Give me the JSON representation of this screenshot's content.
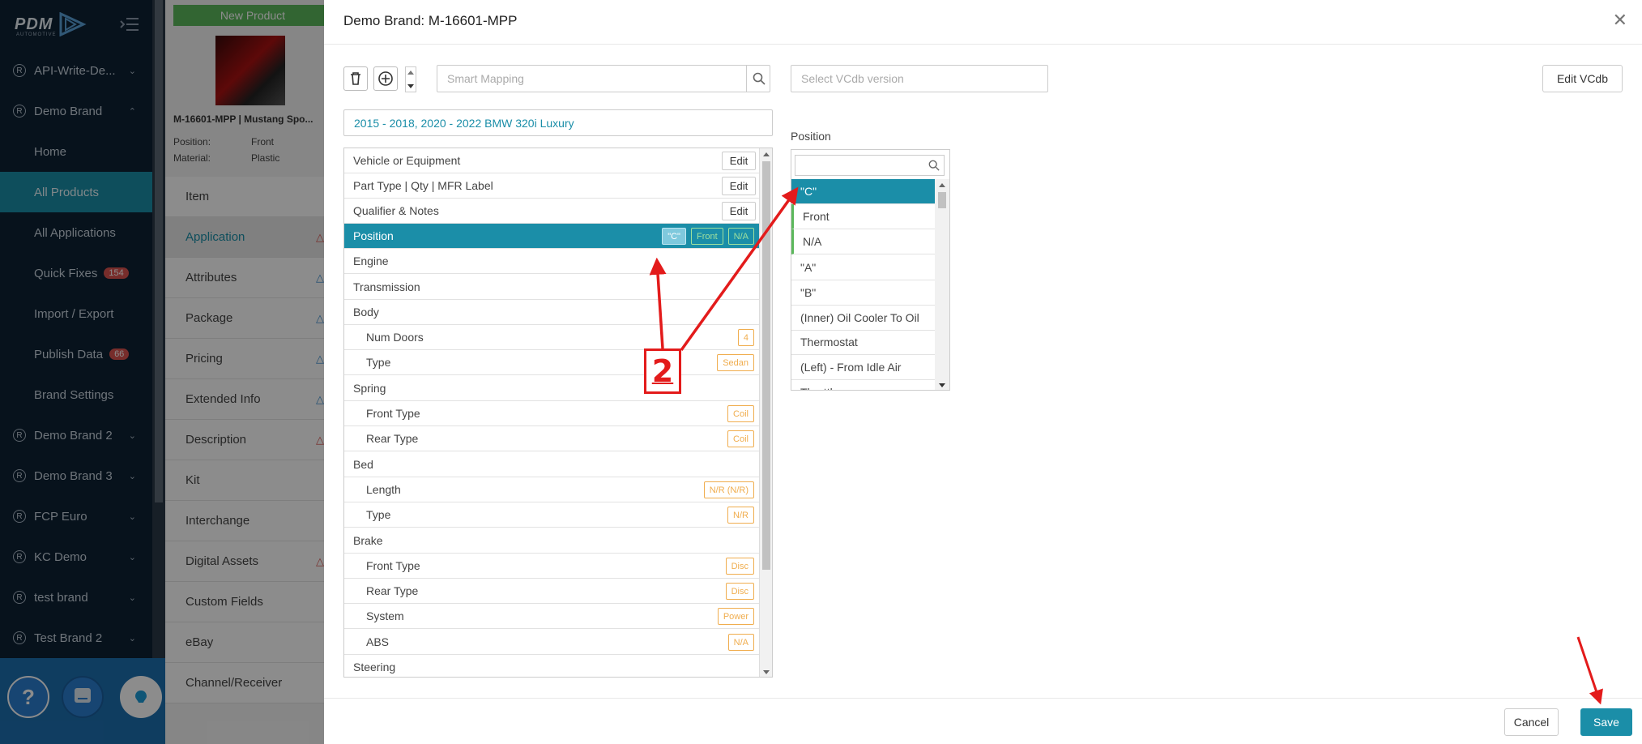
{
  "sidebar": {
    "logo": "PDM",
    "logo_sub": "AUTOMOTIVE",
    "brands": [
      {
        "label": "API-Write-De..."
      },
      {
        "label": "Demo Brand"
      }
    ],
    "demo_items": [
      {
        "label": "Home"
      },
      {
        "label": "All Products"
      },
      {
        "label": "All Applications"
      },
      {
        "label": "Quick Fixes",
        "badge": "154"
      },
      {
        "label": "Import / Export"
      },
      {
        "label": "Publish Data",
        "badge": "66"
      },
      {
        "label": "Brand Settings"
      }
    ],
    "more_brands": [
      {
        "label": "Demo Brand 2"
      },
      {
        "label": "Demo Brand 3"
      },
      {
        "label": "FCP Euro"
      },
      {
        "label": "KC Demo"
      },
      {
        "label": "test brand"
      },
      {
        "label": "Test Brand 2"
      }
    ]
  },
  "product": {
    "new_product_label": "New Product",
    "title": "M-16601-MPP | Mustang Spo...",
    "meta": [
      {
        "key": "Position:",
        "value": "Front"
      },
      {
        "key": "Material:",
        "value": "Plastic"
      }
    ],
    "tabs": [
      {
        "label": "Item"
      },
      {
        "label": "Application",
        "warn": "red"
      },
      {
        "label": "Attributes",
        "warn": "blue"
      },
      {
        "label": "Package",
        "warn": "blue"
      },
      {
        "label": "Pricing",
        "warn": "blue"
      },
      {
        "label": "Extended Info",
        "warn": "blue"
      },
      {
        "label": "Description",
        "warn": "red"
      },
      {
        "label": "Kit"
      },
      {
        "label": "Interchange"
      },
      {
        "label": "Digital Assets",
        "warn": "red"
      },
      {
        "label": "Custom Fields"
      },
      {
        "label": "eBay"
      },
      {
        "label": "Channel/Receiver"
      }
    ]
  },
  "modal": {
    "title": "Demo Brand: M-16601-MPP",
    "smart_mapping_placeholder": "Smart Mapping",
    "vcdb_placeholder": "Select VCdb version",
    "edit_vcdb": "Edit VCdb",
    "vehicle_summary": "2015 - 2018, 2020 - 2022 BMW 320i Luxury",
    "edit_label": "Edit",
    "rows": [
      {
        "label": "Vehicle or Equipment",
        "edit": true
      },
      {
        "label": "Part Type | Qty | MFR Label",
        "edit": true
      },
      {
        "label": "Qualifier & Notes",
        "edit": true
      },
      {
        "label": "Position",
        "selected": true,
        "tags": [
          "\"C\"",
          "Front",
          "N/A"
        ]
      },
      {
        "label": "Engine"
      },
      {
        "label": "Transmission"
      },
      {
        "label": "Body"
      },
      {
        "label": "Num Doors",
        "sub": true,
        "tags": [
          "4"
        ]
      },
      {
        "label": "Type",
        "sub": true,
        "tags": [
          "Sedan"
        ]
      },
      {
        "label": "Spring"
      },
      {
        "label": "Front Type",
        "sub": true,
        "tags": [
          "Coil"
        ]
      },
      {
        "label": "Rear Type",
        "sub": true,
        "tags": [
          "Coil"
        ]
      },
      {
        "label": "Bed"
      },
      {
        "label": "Length",
        "sub": true,
        "tags": [
          "N/R (N/R)"
        ]
      },
      {
        "label": "Type",
        "sub": true,
        "tags": [
          "N/R"
        ]
      },
      {
        "label": "Brake"
      },
      {
        "label": "Front Type",
        "sub": true,
        "tags": [
          "Disc"
        ]
      },
      {
        "label": "Rear Type",
        "sub": true,
        "tags": [
          "Disc"
        ]
      },
      {
        "label": "System",
        "sub": true,
        "tags": [
          "Power"
        ]
      },
      {
        "label": "ABS",
        "sub": true,
        "tags": [
          "N/A"
        ]
      },
      {
        "label": "Steering"
      }
    ],
    "position_label": "Position",
    "position_options": [
      "\"C\"",
      "Front",
      "N/A",
      "\"A\"",
      "\"B\"",
      "(Inner) Oil Cooler To Oil",
      "Thermostat",
      "(Left) - From Idle Air",
      "Throttle"
    ],
    "cancel": "Cancel",
    "save": "Save"
  },
  "annotation": {
    "step": "2",
    "color": "#e31b1b"
  }
}
